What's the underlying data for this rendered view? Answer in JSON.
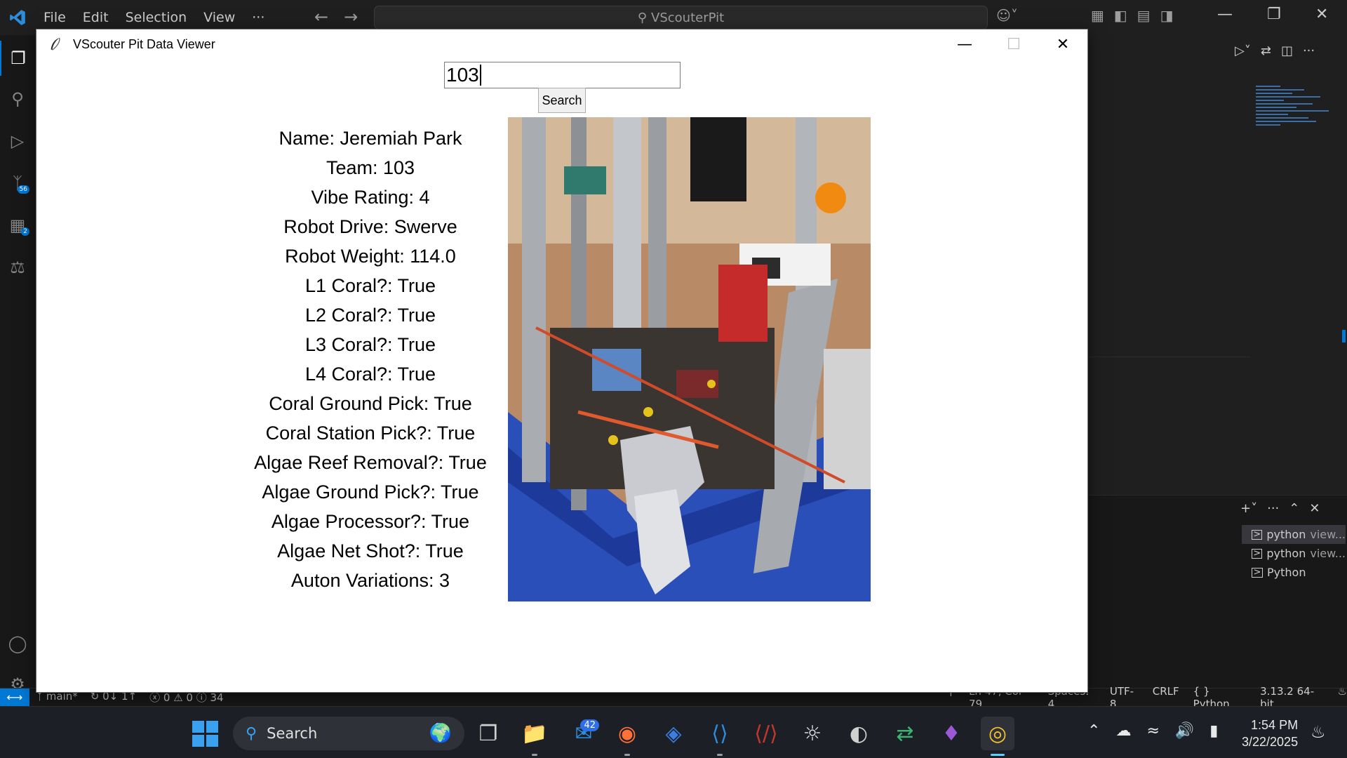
{
  "vscode": {
    "menu": [
      "File",
      "Edit",
      "Selection",
      "View",
      "···"
    ],
    "command_center": "VScouterPit",
    "activity_badges": {
      "source_control": "56",
      "extensions": "2"
    },
    "terminals": [
      {
        "name": "python",
        "detail": "view..."
      },
      {
        "name": "python",
        "detail": "view..."
      },
      {
        "name": "Python",
        "detail": ""
      }
    ],
    "status_left": {
      "branch": "main*",
      "sync": "0↓ 1↑",
      "problems": "ⓧ 0 ⚠ 0 ⓘ 34"
    },
    "status_right": {
      "position": "Ln 47, Col 79",
      "spaces": "Spaces: 4",
      "encoding": "UTF-8",
      "eol": "CRLF",
      "language": "{ } Python",
      "interpreter": "3.13.2 64-bit"
    },
    "colors": {
      "accent": "#0078d4",
      "bg": "#1f1f1f"
    }
  },
  "app": {
    "title": "VScouter Pit Data Viewer",
    "search_value": "103",
    "search_button": "Search",
    "info": [
      "Name: Jeremiah Park",
      "Team: 103",
      "Vibe Rating: 4",
      "Robot Drive: Swerve",
      "Robot Weight: 114.0",
      "L1 Coral?: True",
      "L2 Coral?: True",
      "L3 Coral?: True",
      "L4 Coral?: True",
      "Coral Ground Pick: True",
      "Coral Station Pick?: True",
      "Algae Reef Removal?: True",
      "Algae Ground Pick?: True",
      "Algae Processor?: True",
      "Algae Net Shot?: True",
      "Auton Variations: 3"
    ]
  },
  "taskbar": {
    "search_label": "Search",
    "mail_badge": "42",
    "time": "1:54 PM",
    "date": "3/22/2025"
  }
}
